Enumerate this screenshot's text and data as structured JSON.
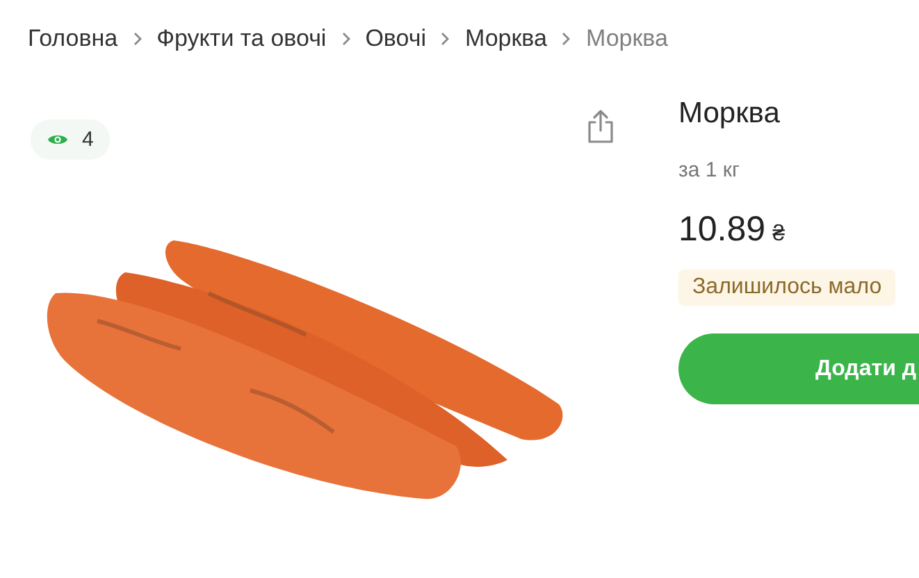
{
  "breadcrumbs": [
    {
      "label": "Головна",
      "current": false
    },
    {
      "label": "Фрукти та овочі",
      "current": false
    },
    {
      "label": "Овочі",
      "current": false
    },
    {
      "label": "Морква",
      "current": false
    },
    {
      "label": "Морква",
      "current": true
    }
  ],
  "gallery": {
    "views": "4"
  },
  "product": {
    "title": "Морква",
    "unit": "за 1 кг",
    "price": "10.89",
    "currency": "₴",
    "stock_badge": "Залишилось мало",
    "add_button": "Додати д"
  }
}
